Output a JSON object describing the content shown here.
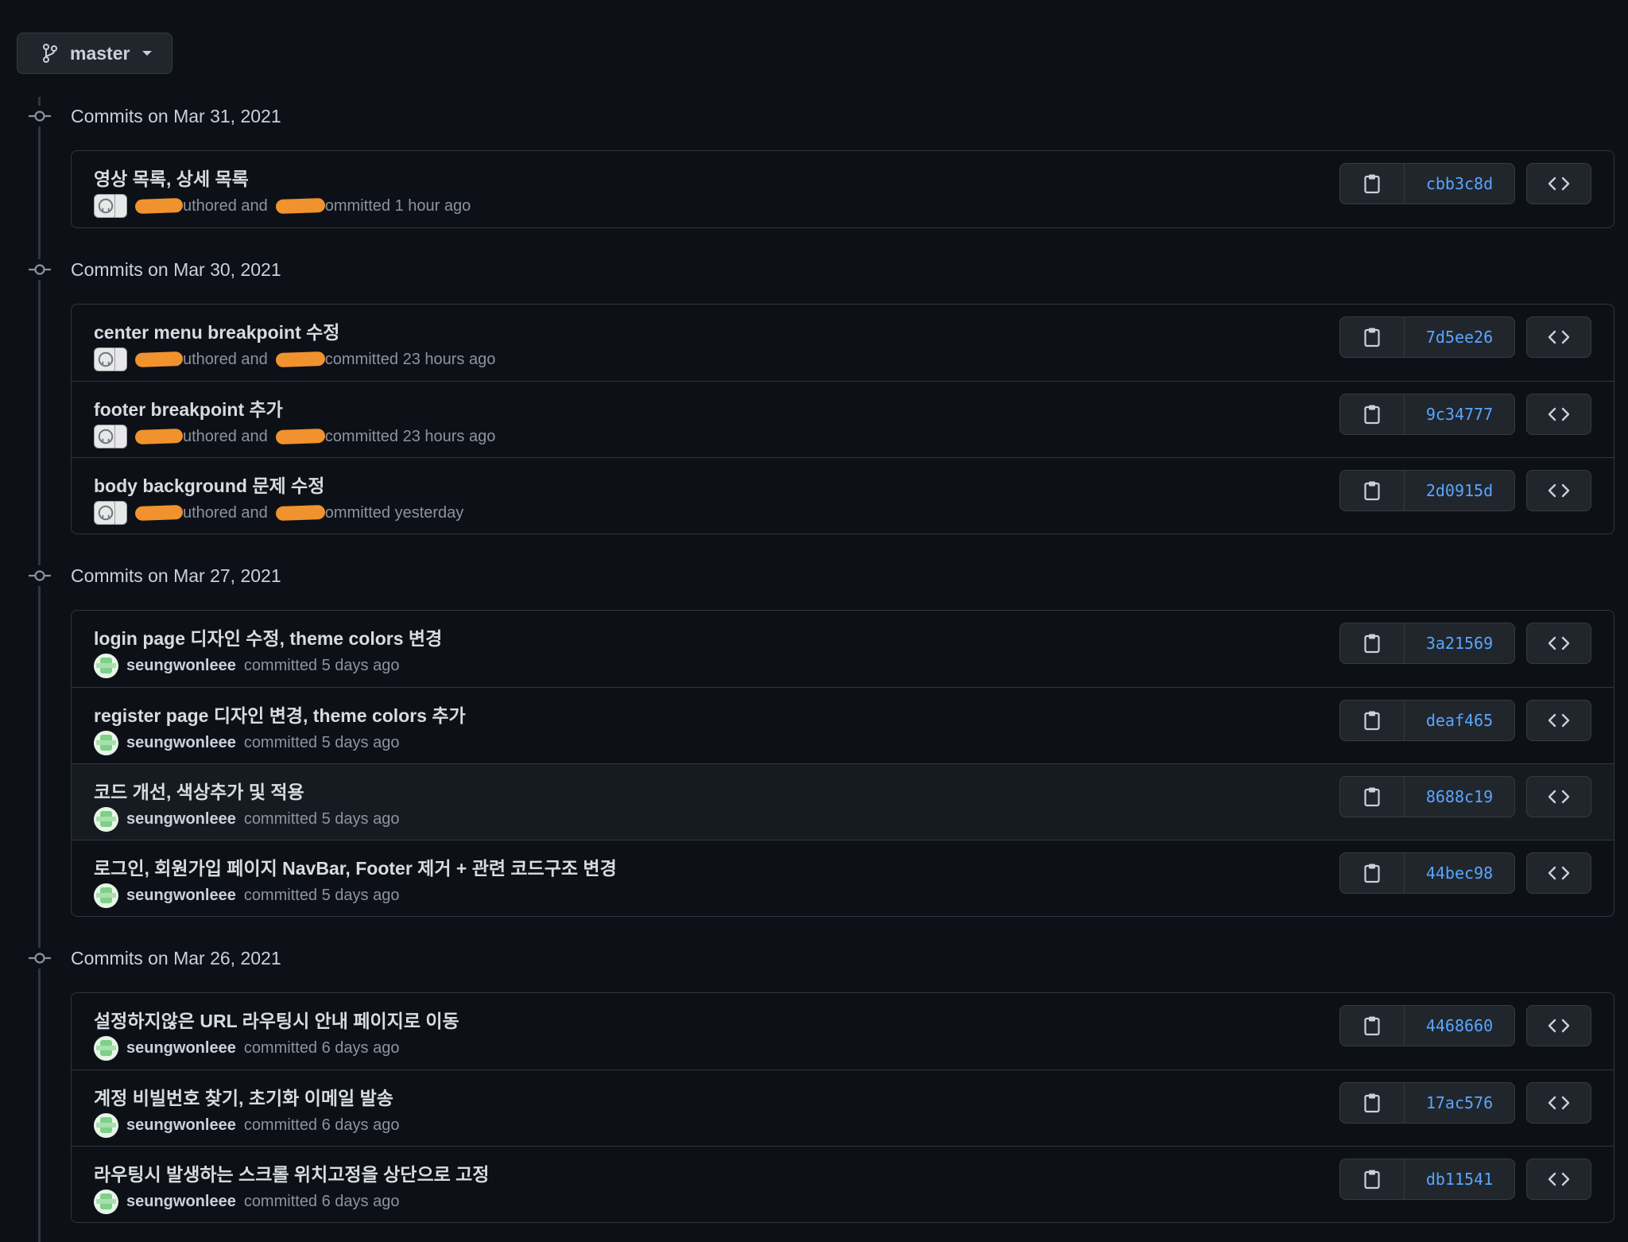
{
  "branch": {
    "name": "master",
    "icon": "git-branch-icon"
  },
  "groups": [
    {
      "date": "Commits on Mar 31, 2021",
      "commits": [
        {
          "message": "영상 목록, 상세 목록",
          "authored_suffix": "uthored and",
          "committed_suffix": "ommitted 1 hour ago",
          "sha": "cbb3c8d"
        }
      ]
    },
    {
      "date": "Commits on Mar 30, 2021",
      "commits": [
        {
          "message": "center menu breakpoint 수정",
          "authored_suffix": "uthored and",
          "committed_suffix": "committed 23 hours ago",
          "sha": "7d5ee26"
        },
        {
          "message": "footer breakpoint 추가",
          "authored_suffix": "uthored and",
          "committed_suffix": "committed 23 hours ago",
          "sha": "9c34777"
        },
        {
          "message": "body background 문제 수정",
          "authored_suffix": "uthored and",
          "committed_suffix": "ommitted yesterday",
          "sha": "2d0915d"
        }
      ]
    },
    {
      "date": "Commits on Mar 27, 2021",
      "commits": [
        {
          "message": "login page 디자인 수정, theme colors 변경",
          "author": "seungwonleee",
          "time": "committed 5 days ago",
          "sha": "3a21569"
        },
        {
          "message": "register page 디자인 변경, theme colors 추가",
          "author": "seungwonleee",
          "time": "committed 5 days ago",
          "sha": "deaf465"
        },
        {
          "message": "코드 개선, 색상추가 및 적용",
          "author": "seungwonleee",
          "time": "committed 5 days ago",
          "sha": "8688c19"
        },
        {
          "message": "로그인, 회원가입 페이지 NavBar, Footer 제거 + 관련 코드구조 변경",
          "author": "seungwonleee",
          "time": "committed 5 days ago",
          "sha": "44bec98"
        }
      ]
    },
    {
      "date": "Commits on Mar 26, 2021",
      "commits": [
        {
          "message": "설정하지않은 URL 라우팅시 안내 페이지로 이동",
          "author": "seungwonleee",
          "time": "committed 6 days ago",
          "sha": "4468660"
        },
        {
          "message": "계정 비빌번호 찾기, 초기화 이메일 발송",
          "author": "seungwonleee",
          "time": "committed 6 days ago",
          "sha": "17ac576"
        },
        {
          "message": "라우팅시 발생하는 스크롤 위치고정을 상단으로 고정",
          "author": "seungwonleee",
          "time": "committed 6 days ago",
          "sha": "db11541"
        }
      ]
    }
  ],
  "icons": {
    "copy": "clipboard-icon",
    "browse": "code-icon",
    "commit": "git-commit-icon"
  },
  "colors": {
    "background": "#0d1117",
    "link": "#58a6ff",
    "redaction": "#f0922e",
    "border": "#30363d"
  }
}
